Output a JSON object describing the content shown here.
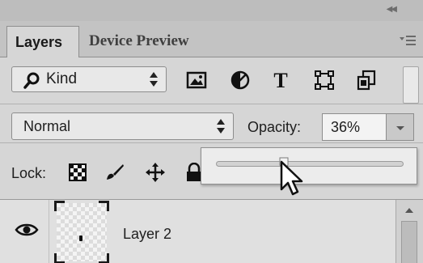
{
  "tabs": [
    {
      "label": "Layers",
      "active": true
    },
    {
      "label": "Device Preview",
      "active": false
    }
  ],
  "filter": {
    "kind_label": "Kind",
    "filter_icons": [
      "image-filter-icon",
      "adjustment-filter-icon",
      "type-filter-icon",
      "shape-filter-icon",
      "smart-object-filter-icon"
    ],
    "type_glyph": "T"
  },
  "blend": {
    "mode": "Normal"
  },
  "opacity": {
    "label": "Opacity:",
    "value": "36%",
    "slider_level": 0.36
  },
  "lock": {
    "label": "Lock:",
    "icons": [
      "lock-transparent-pixels-icon",
      "lock-image-pixels-icon",
      "lock-position-icon",
      "lock-all-icon"
    ]
  },
  "layers": [
    {
      "name": "Layer 2",
      "visible": true
    }
  ],
  "colors": {
    "panel_bg": "#d6d6d6",
    "tab_bar_bg": "#c3c3c3",
    "field_bg": "#e8e8e8",
    "text": "#1e1e1e"
  }
}
